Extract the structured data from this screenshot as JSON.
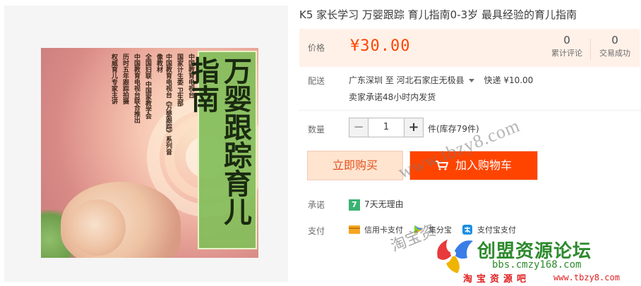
{
  "product": {
    "title": "K5 家长学习 万婴跟踪 育儿指南0-3岁 最具经验的育儿指南",
    "cover_title": "万婴跟踪育儿指南",
    "cover_credits": [
      "中国教育电视台",
      "国家计生委 卫生部",
      "中国教育电视台《万婴跟踪》系列音像教材",
      "全国妇联 中国家教学会",
      "中国教育电视台联合推出",
      "历时五年跟踪拍摄",
      "权威育儿专家主讲"
    ]
  },
  "price": {
    "label": "价格",
    "value": "¥30.00",
    "reviews_count": "0",
    "reviews_label": "累计评论",
    "sales_count": "0",
    "sales_label": "交易成功"
  },
  "shipping": {
    "label": "配送",
    "from": "广东深圳 至",
    "to": "河北石家庄无极县",
    "method": "快递 ¥10.00",
    "promise": "卖家承诺48小时内发货"
  },
  "quantity": {
    "label": "数量",
    "minus": "−",
    "value": "1",
    "plus": "+",
    "stock": "件(库存79件)"
  },
  "actions": {
    "buy_now": "立即购买",
    "add_to_cart": "加入购物车"
  },
  "promise": {
    "label": "承诺",
    "badge": "7",
    "text": "7天无理由"
  },
  "payment": {
    "label": "支付",
    "methods": [
      "信用卡支付",
      "集分宝",
      "支付宝支付"
    ]
  },
  "watermark": {
    "url": "www.tbzy8.com",
    "taobao": "淘宝资",
    "forum": "创盟资源论坛",
    "bbs": "bbs.cmzy168.com",
    "bottom_left": "淘宝资源吧",
    "bottom_right": "www.tbzy8.com"
  },
  "colors": {
    "accent": "#ff4400",
    "price_bg": "#fff1e8",
    "buy_bg": "#ffe4d0",
    "promise_green": "#3bb273",
    "forum_green": "#2d8a2d"
  }
}
